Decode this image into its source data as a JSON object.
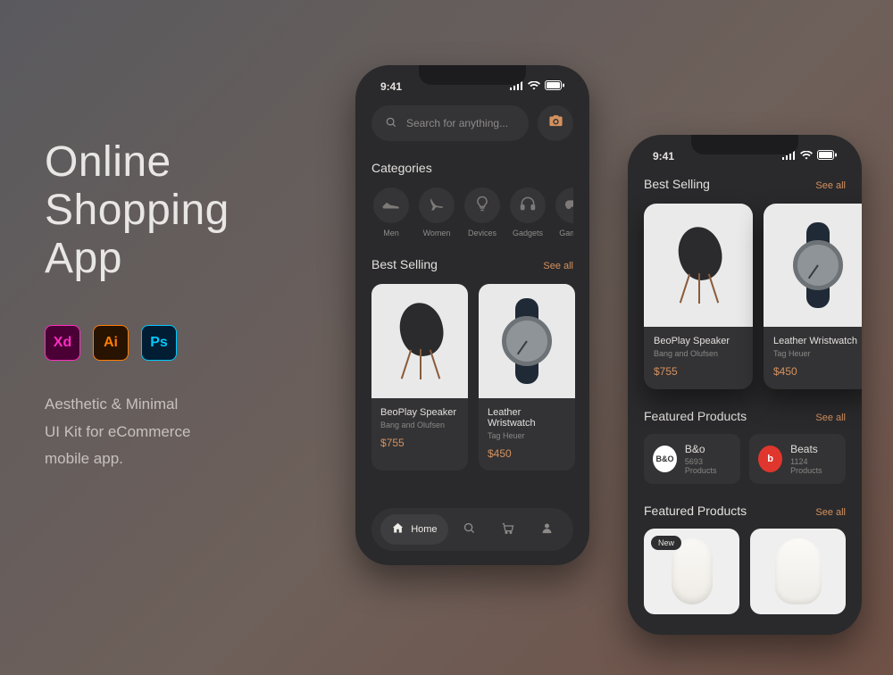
{
  "hero": {
    "title_l1": "Online",
    "title_l2": "Shopping",
    "title_l3": "App",
    "xd": "Xd",
    "ai": "Ai",
    "ps": "Ps",
    "tagline_l1": "Aesthetic & Minimal",
    "tagline_l2": "UI Kit for eCommerce",
    "tagline_l3": "mobile app."
  },
  "status": {
    "time": "9:41"
  },
  "search": {
    "placeholder": "Search for anything..."
  },
  "sections": {
    "categories": "Categories",
    "best_selling": "Best Selling",
    "see_all": "See all",
    "featured_products": "Featured Products"
  },
  "categories": [
    {
      "label": "Men",
      "icon": "sneaker-icon"
    },
    {
      "label": "Women",
      "icon": "heel-icon"
    },
    {
      "label": "Devices",
      "icon": "bulb-icon"
    },
    {
      "label": "Gadgets",
      "icon": "headphones-icon"
    },
    {
      "label": "Gaming",
      "icon": "gamepad-icon"
    }
  ],
  "products": [
    {
      "name": "BeoPlay Speaker",
      "brand": "Bang and Olufsen",
      "price": "$755"
    },
    {
      "name": "Leather Wristwatch",
      "brand": "Tag Heuer",
      "price": "$450"
    }
  ],
  "nav": {
    "home": "Home"
  },
  "brands": [
    {
      "code": "bo",
      "name": "B&o",
      "count": "5693 Products",
      "logo": "B&O"
    },
    {
      "code": "beats",
      "name": "Beats",
      "count": "1124 Products",
      "logo": "b"
    }
  ],
  "badge": {
    "new": "New"
  }
}
